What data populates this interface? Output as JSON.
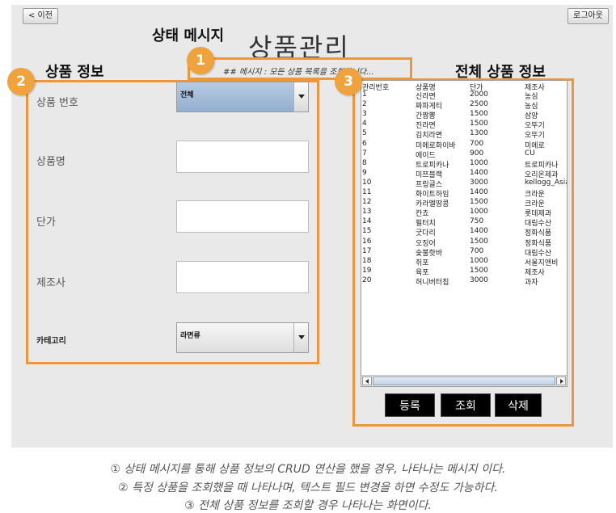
{
  "toolbar": {
    "back_label": "< 이전",
    "logout_label": "로그아웃"
  },
  "annotations": {
    "status_heading": "상태 메시지",
    "product_heading": "상품 정보",
    "all_heading": "전체 상품 정보",
    "badge1": "1",
    "badge2": "2",
    "badge3": "3"
  },
  "page_title": "상품관리",
  "status_message": "## 메시지 : 모든 상품 목록을 조회합니다...",
  "form": {
    "product_no_label": "상품 번호",
    "product_no_value": "전체",
    "name_label": "상품명",
    "price_label": "단가",
    "maker_label": "제조사",
    "category_label": "카테고리",
    "category_value": "라면류"
  },
  "list": {
    "headers": [
      "관리번호",
      "상품명",
      "단가",
      "제조사"
    ],
    "rows": [
      [
        "1",
        "신라면",
        "2000",
        "농심"
      ],
      [
        "2",
        "짜파게티",
        "2500",
        "농심"
      ],
      [
        "3",
        "간짬뽕",
        "1500",
        "삼양"
      ],
      [
        "4",
        "진라면",
        "1500",
        "오뚜기"
      ],
      [
        "5",
        "김치라면",
        "1300",
        "오뚜기"
      ],
      [
        "6",
        "미에로화이바",
        "700",
        "미에로"
      ],
      [
        "7",
        "에이드",
        "900",
        "CU"
      ],
      [
        "8",
        "트로피카나",
        "1000",
        "트로피카나"
      ],
      [
        "9",
        "미쯔블랙",
        "1400",
        "오리온제과"
      ],
      [
        "10",
        "프링글스",
        "3000",
        "kellogg_Asia"
      ],
      [
        "11",
        "화이트하임",
        "1400",
        "크라운"
      ],
      [
        "12",
        "카라멜땅콩",
        "1500",
        "크라운"
      ],
      [
        "13",
        "칸쵸",
        "1000",
        "롯데제과"
      ],
      [
        "14",
        "필터치",
        "750",
        "대림수산"
      ],
      [
        "15",
        "굿다리",
        "1400",
        "정화식품"
      ],
      [
        "16",
        "오징어",
        "1500",
        "정화식품"
      ],
      [
        "17",
        "숯불핫바",
        "700",
        "대림수산"
      ],
      [
        "18",
        "쥐포",
        "1000",
        "서울지앤비"
      ],
      [
        "19",
        "육포",
        "1500",
        "제조사"
      ],
      [
        "20",
        "허니버터칩",
        "3000",
        "과자"
      ]
    ]
  },
  "actions": {
    "insert": "등록",
    "select": "조회",
    "delete": "삭제"
  },
  "captions": [
    "① 상태 메시지를 통해 상품 정보의 CRUD 연산을 했을 경우, 나타나는 메시지 이다.",
    "② 특정 상품을 조회했을 때 나타나며, 텍스트 필드 변경을 하면 수정도 가능하다.",
    "③ 전체 상품 정보를 조회할 경우 나타나는 화면이다."
  ],
  "colors": {
    "accent": "#f0963a",
    "badge": "#f0a23c",
    "combo_active": "#a3bcd9"
  }
}
